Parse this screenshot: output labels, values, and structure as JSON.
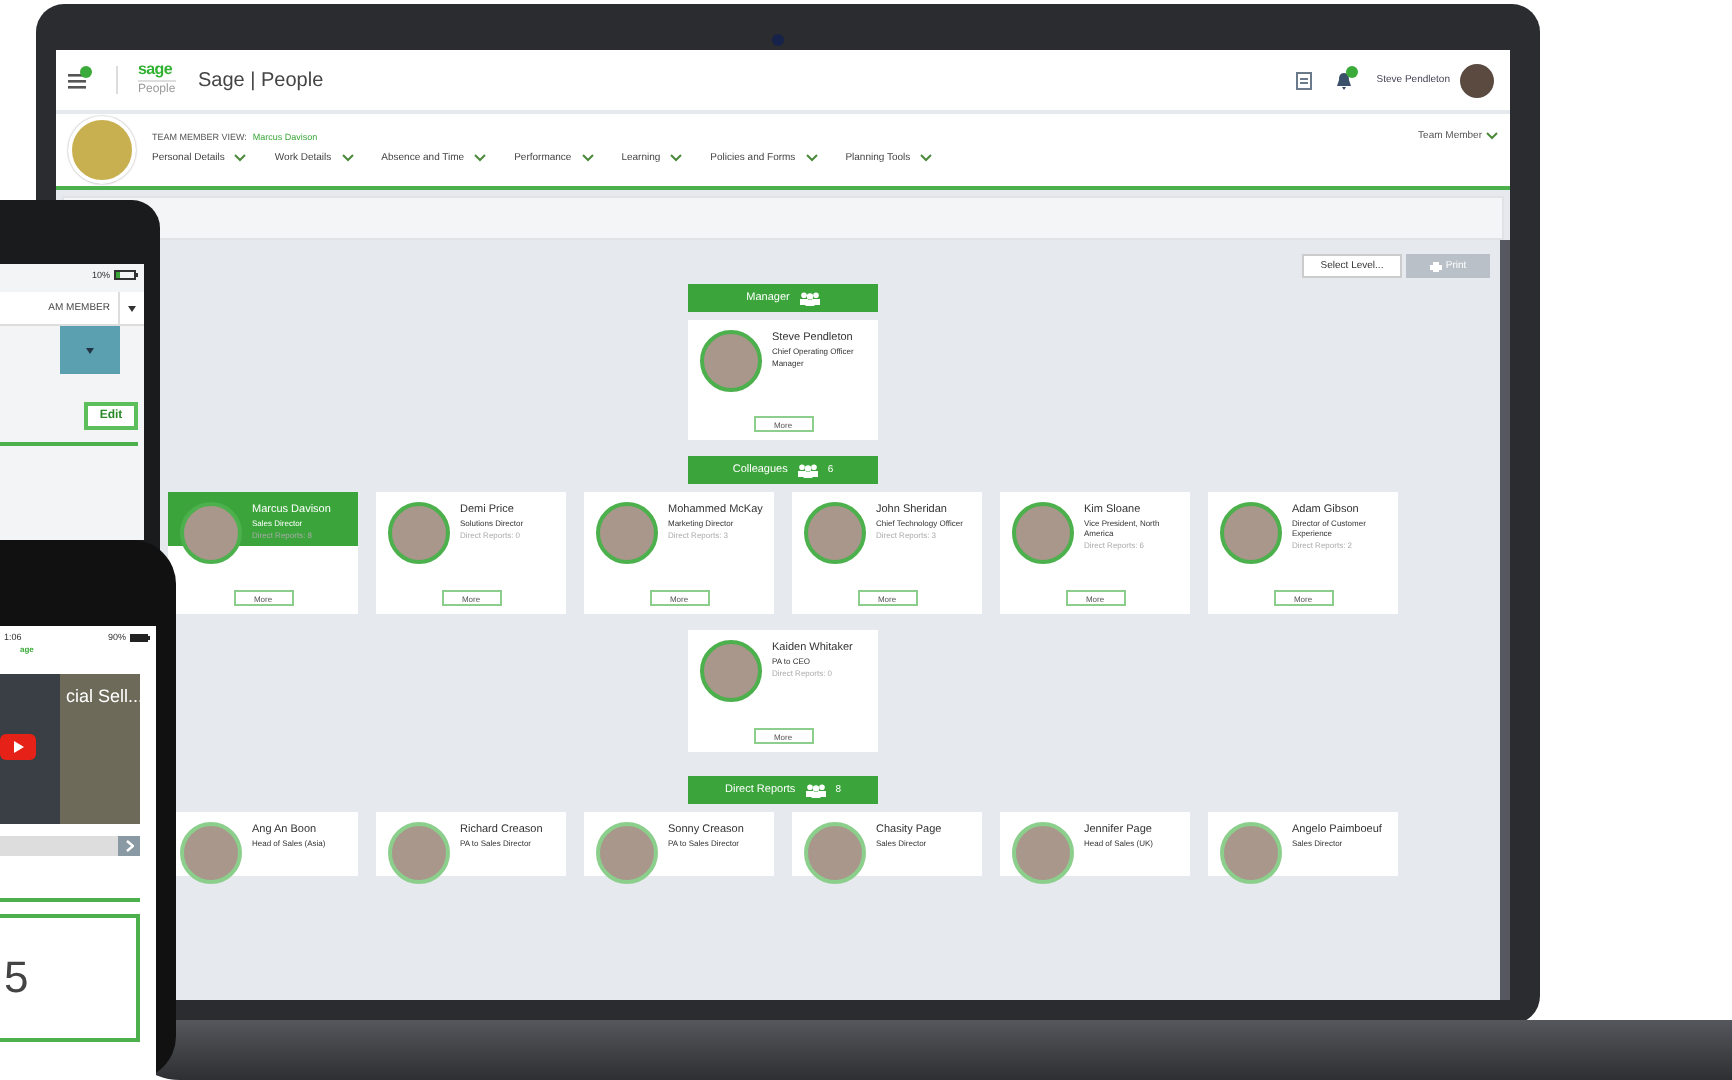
{
  "app_bar": {
    "logo": {
      "brand": "sage",
      "sub": "People"
    },
    "title": "Sage | People",
    "user": "Steve Pendleton",
    "has_notifications": true
  },
  "member_bar": {
    "view_label": "TEAM MEMBER VIEW:",
    "member": "Marcus Davison",
    "role_menu": "Team Member",
    "nav": [
      "Personal Details",
      "Work Details",
      "Absence and Time",
      "Performance",
      "Learning",
      "Policies and Forms",
      "Planning Tools"
    ]
  },
  "toolbar": {
    "select_level": "Select Level...",
    "print": {
      "label": "Print",
      "disabled": true
    }
  },
  "org_chart": {
    "sections": [
      {
        "kind": "manager",
        "title": "Manager",
        "cards": [
          {
            "name": "Steve Pendleton",
            "title": "Chief Operating Officer",
            "detail": "Manager",
            "more": "More",
            "selected": false
          }
        ]
      },
      {
        "kind": "colleagues",
        "title": "Colleagues",
        "count": "6",
        "cards": [
          {
            "name": "Marcus Davison",
            "title": "Sales Director",
            "detail": "Direct Reports: 8",
            "more": "More",
            "selected": true
          },
          {
            "name": "Demi Price",
            "title": "Solutions Director",
            "detail": "Direct Reports: 0",
            "more": "More",
            "selected": false
          },
          {
            "name": "Mohammed McKay",
            "title": "Marketing Director",
            "detail": "Direct Reports: 3",
            "more": "More",
            "selected": false
          },
          {
            "name": "John Sheridan",
            "title": "Chief Technology Officer",
            "detail": "Direct Reports: 3",
            "more": "More",
            "selected": false
          },
          {
            "name": "Kim Sloane",
            "title": "Vice President, North America",
            "detail": "Direct Reports: 6",
            "more": "More",
            "selected": false
          },
          {
            "name": "Adam Gibson",
            "title": "Director of Customer Experience",
            "detail": "Direct Reports: 2",
            "more": "More",
            "selected": false
          },
          {
            "name": "Kaiden Whitaker",
            "title": "PA to CEO",
            "detail": "Direct Reports: 0",
            "more": "More",
            "selected": false
          }
        ]
      },
      {
        "kind": "reports",
        "title": "Direct Reports",
        "count": "8",
        "cards": [
          {
            "name": "Ang An Boon",
            "title": "Head of Sales (Asia)",
            "selected": false
          },
          {
            "name": "Richard Creason",
            "title": "PA to Sales Director",
            "selected": false
          },
          {
            "name": "Sonny Creason",
            "title": "PA to Sales Director",
            "selected": false
          },
          {
            "name": "Chasity Page",
            "title": "Sales Director",
            "selected": false
          },
          {
            "name": "Jennifer Page",
            "title": "Head of Sales (UK)",
            "selected": false
          },
          {
            "name": "Angelo Paimboeuf",
            "title": "Sales Director",
            "selected": false
          }
        ]
      }
    ]
  },
  "tablet": {
    "battery": "10%",
    "menu": "AM MEMBER",
    "edit": "Edit"
  },
  "phone": {
    "time": "1:06",
    "brand": "age",
    "battery": "90%",
    "video_title": "cial Sell...",
    "figure": "5"
  }
}
